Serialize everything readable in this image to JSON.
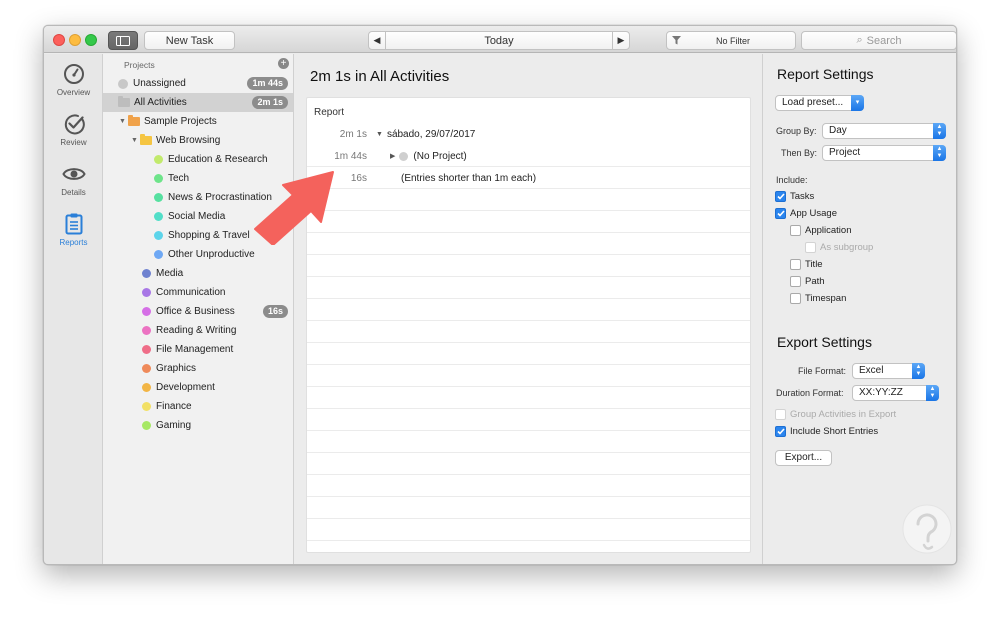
{
  "toolbar": {
    "new_task": "New Task",
    "date_label": "Today",
    "prev_icon": "chevron-left-icon",
    "next_icon": "chevron-right-icon",
    "filter_label": "No Filter",
    "search_placeholder": "Search"
  },
  "iconbar": [
    {
      "label": "Overview",
      "icon": "gauge-icon",
      "active": false
    },
    {
      "label": "Review",
      "icon": "checkmark-circle-icon",
      "active": false
    },
    {
      "label": "Details",
      "icon": "eye-icon",
      "active": false
    },
    {
      "label": "Reports",
      "icon": "clipboard-icon",
      "active": true
    }
  ],
  "projects": {
    "header": "Projects",
    "items": [
      {
        "label": "Unassigned",
        "color": "#c8c8c8",
        "badge": "1m 44s"
      },
      {
        "label": "All Activities",
        "color": "#bdbdbd",
        "badge": "2m 1s",
        "selected": true
      },
      {
        "label": "Sample Projects",
        "color": "#f0a24a"
      },
      {
        "label": "Web Browsing",
        "color": "#f5c542"
      },
      {
        "label": "Education & Research",
        "color": "#c2ea6c"
      },
      {
        "label": "Tech",
        "color": "#6ee48a"
      },
      {
        "label": "News & Procrastination",
        "color": "#56e0a0"
      },
      {
        "label": "Social Media",
        "color": "#52dec8"
      },
      {
        "label": "Shopping & Travel",
        "color": "#5cd4ea"
      },
      {
        "label": "Other Unproductive",
        "color": "#6ea8f4"
      },
      {
        "label": "Media",
        "color": "#6f82d0"
      },
      {
        "label": "Communication",
        "color": "#a877e6"
      },
      {
        "label": "Office & Business",
        "color": "#d56fe6",
        "badge": "16s"
      },
      {
        "label": "Reading & Writing",
        "color": "#ec72c2"
      },
      {
        "label": "File Management",
        "color": "#ef6d88"
      },
      {
        "label": "Graphics",
        "color": "#ef8a5a"
      },
      {
        "label": "Development",
        "color": "#f2b545"
      },
      {
        "label": "Finance",
        "color": "#f2e065"
      },
      {
        "label": "Gaming",
        "color": "#a6e864"
      }
    ]
  },
  "main": {
    "title": "2m 1s in All Activities",
    "report_label": "Report",
    "rows": [
      {
        "duration": "2m 1s",
        "text": "sábado, 29/07/2017"
      },
      {
        "duration": "1m 44s",
        "text": "(No Project)"
      },
      {
        "duration": "16s",
        "text": "(Entries shorter than 1m each)"
      }
    ]
  },
  "report_settings": {
    "title": "Report Settings",
    "load_preset": "Load preset...",
    "group_by_label": "Group By:",
    "group_by_value": "Day",
    "then_by_label": "Then By:",
    "then_by_value": "Project",
    "include_label": "Include:",
    "options": [
      {
        "label": "Tasks",
        "checked": true
      },
      {
        "label": "App Usage",
        "checked": true
      },
      {
        "label": "Application",
        "checked": false
      },
      {
        "label": "As subgroup",
        "checked": false,
        "disabled": true
      },
      {
        "label": "Title",
        "checked": false
      },
      {
        "label": "Path",
        "checked": false
      },
      {
        "label": "Timespan",
        "checked": false
      }
    ]
  },
  "export_settings": {
    "title": "Export Settings",
    "file_format_label": "File Format:",
    "file_format_value": "Excel",
    "duration_format_label": "Duration Format:",
    "duration_format_value": "XX:YY:ZZ",
    "group_activities": "Group Activities in Export",
    "include_short": "Include Short Entries",
    "export_button": "Export..."
  },
  "colors": {
    "accent": "#2b85ee",
    "arrow": "#f4625c"
  }
}
